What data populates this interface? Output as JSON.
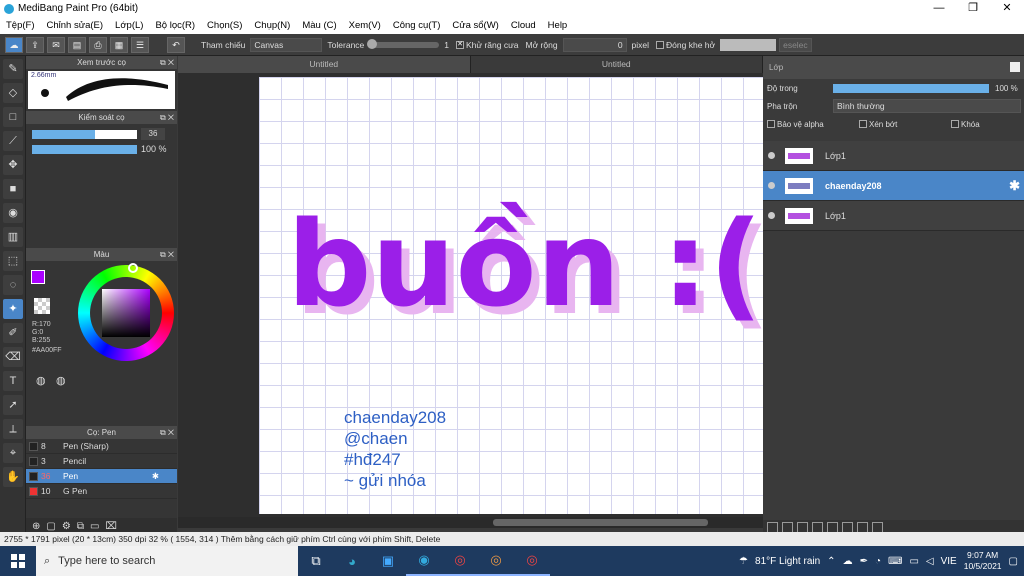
{
  "window": {
    "title": "MediBang Paint Pro (64bit)",
    "controls": [
      "—",
      "❐",
      "✕"
    ]
  },
  "menu": [
    "Tệp(F)",
    "Chỉnh sửa(E)",
    "Lớp(L)",
    "Bộ lọc(R)",
    "Chọn(S)",
    "Chụp(N)",
    "Màu (C)",
    "Xem(V)",
    "Công cụ(T)",
    "Cửa sổ(W)",
    "Cloud",
    "Help"
  ],
  "toolbar": {
    "reference_label": "Tham chiếu",
    "reference_value": "Canvas",
    "tolerance_label": "Tolerance",
    "tolerance_value": "1",
    "tolerance_fraction": 0.02,
    "antialias_label": "Khử răng cưa",
    "antialias_checked": true,
    "expand_label": "Mở rộng",
    "expand_value": "0",
    "expand_unit": "pixel",
    "close_gap_label": "Đóng khe hở",
    "deselect_label": "eselec"
  },
  "brush_preview": {
    "title": "Xem trước cọ",
    "size": "2.66mm"
  },
  "brush_control": {
    "title": "Kiểm soát cọ",
    "size_value": "36",
    "size_fraction": 0.6,
    "opacity_value": "100 %",
    "opacity_fraction": 1.0
  },
  "color": {
    "title": "Màu",
    "r": "R:170",
    "g": "G:0",
    "b": "B:255",
    "hex": "#AA00FF",
    "foreground": "#AA00FF"
  },
  "brushes": {
    "title": "Cọ: Pen",
    "items": [
      {
        "size": "8",
        "name": "Pen (Sharp)",
        "selected": false
      },
      {
        "size": "3",
        "name": "Pencil",
        "selected": false
      },
      {
        "size": "36",
        "name": "Pen",
        "selected": true
      },
      {
        "size": "10",
        "name": "G Pen",
        "selected": false
      }
    ]
  },
  "documents": {
    "tabs": [
      "Untitled",
      "Untitled"
    ]
  },
  "canvas": {
    "lettering": "buồn :(",
    "signature_lines": [
      "chaenday208",
      "@chaen",
      "#hđ247",
      "~ gửi nhóa"
    ],
    "lettering_color": "#9b1fe8"
  },
  "layers": {
    "title": "Lớp",
    "opacity_label": "Độ trong",
    "opacity_value": "100 %",
    "opacity_fraction": 1.0,
    "blend_label": "Pha trộn",
    "blend_value": "Bình thường",
    "alpha_label": "Bảo vệ alpha",
    "clip_label": "Xén bớt",
    "lock_label": "Khóa",
    "items": [
      {
        "name": "Lớp1",
        "selected": false
      },
      {
        "name": "chaenday208",
        "selected": true
      },
      {
        "name": "Lớp1",
        "selected": false
      }
    ]
  },
  "status": {
    "text": "2755 * 1791 pixel  (20 * 13cm)  350 dpi  32 %  ( 1554, 314 )  Thêm bằng cách giữ phím Ctrl cùng với phím Shift, Delete"
  },
  "taskbar": {
    "search_placeholder": "Type here to search",
    "weather": "81°F  Light rain",
    "lang": "VIE",
    "time": "9:07 AM",
    "date": "10/5/2021"
  }
}
